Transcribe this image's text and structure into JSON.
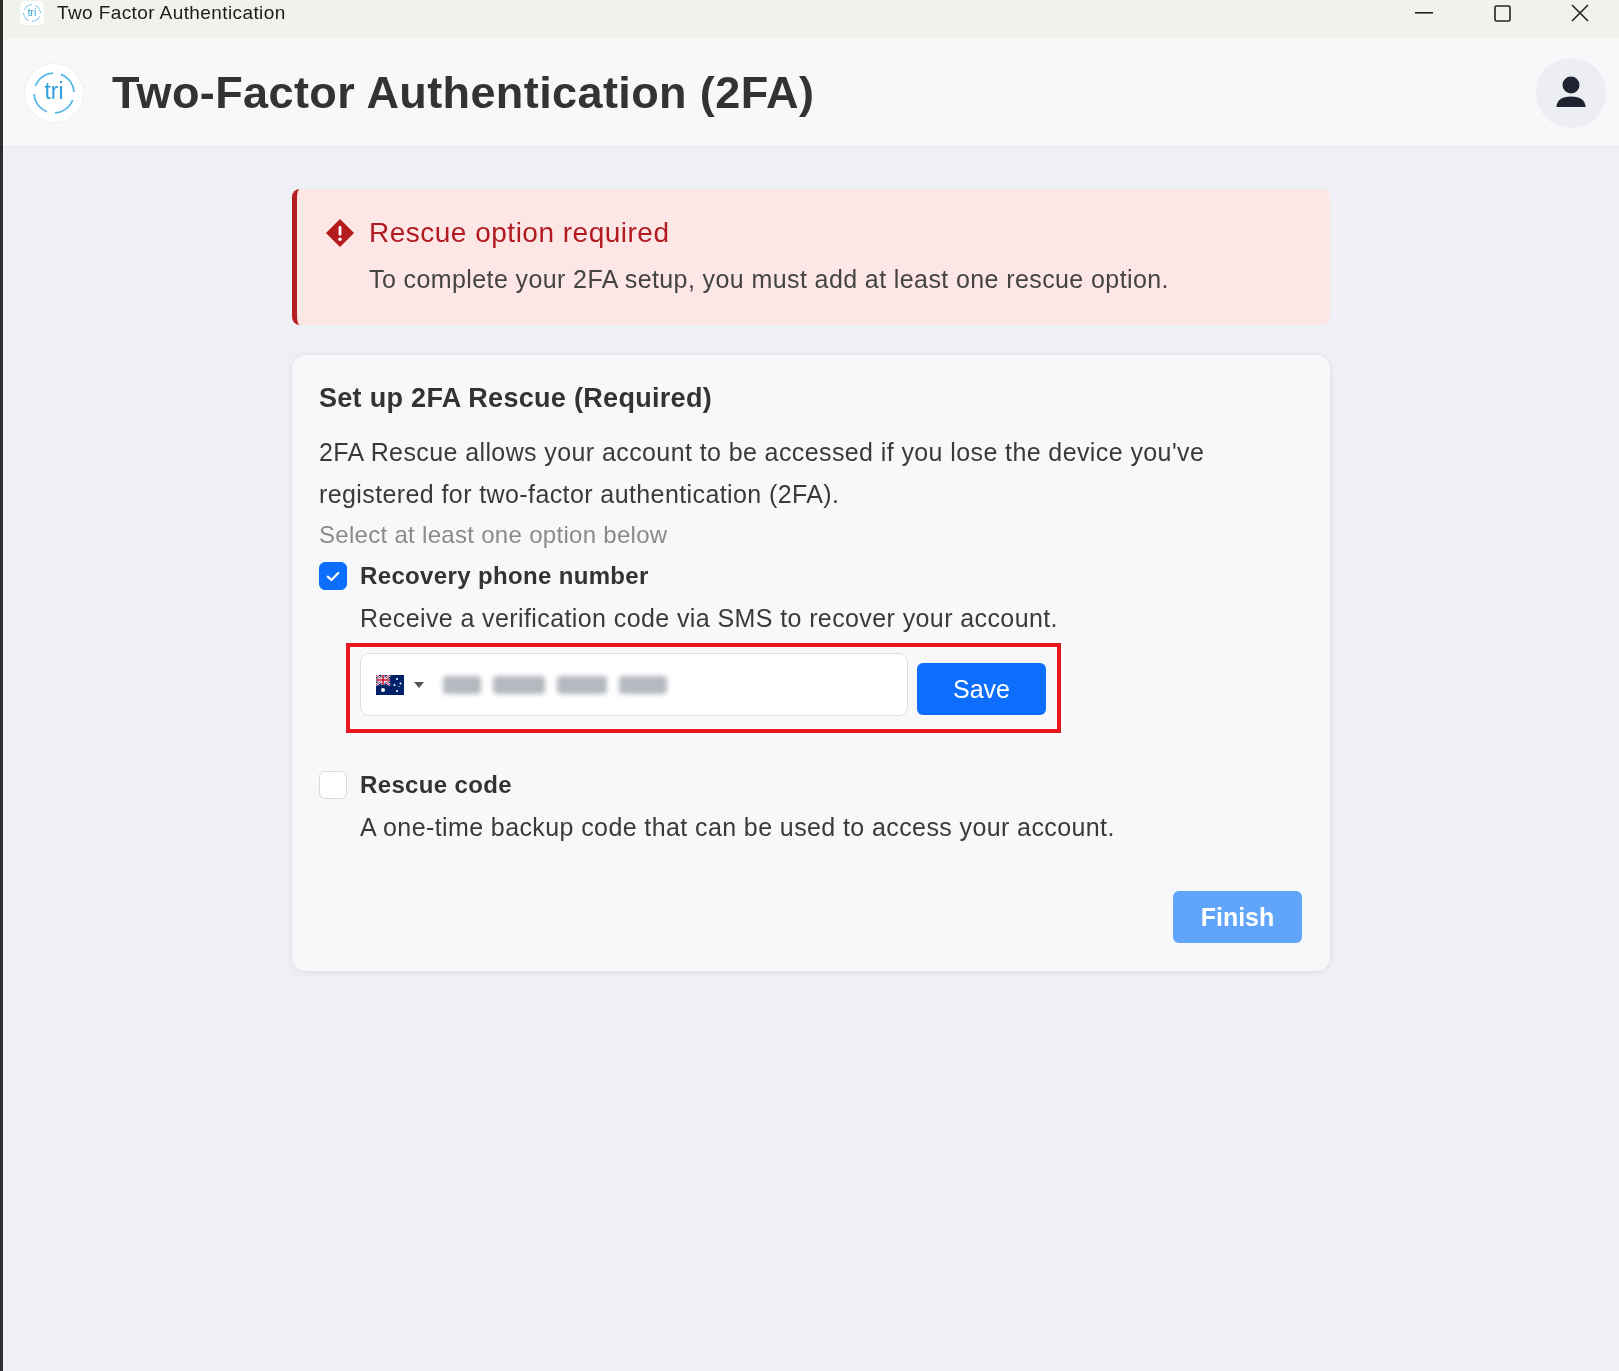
{
  "window": {
    "icon_text": "tri",
    "title": "Two Factor Authentication"
  },
  "header": {
    "logo_text": "tri",
    "title": "Two-Factor Authentication (2FA)"
  },
  "alert": {
    "title": "Rescue option required",
    "message": "To complete your 2FA setup, you must add at least one rescue option."
  },
  "rescue_card": {
    "title": "Set up 2FA Rescue (Required)",
    "description": "2FA Rescue allows your account to be accessed if you lose the device you've registered for two-factor authentication (2FA).",
    "hint": "Select at least one option below",
    "options": [
      {
        "kind": "phone",
        "label": "Recovery phone number",
        "description": "Receive a verification code via SMS to recover your account.",
        "checked": true,
        "highlighted": true,
        "phone_field": {
          "number_blurred": true
        },
        "save_button": {
          "label": "Save",
          "disabled": false
        }
      },
      {
        "kind": "code",
        "label": "Rescue code",
        "description": "A one-time backup code that can be used to access your account.",
        "checked": false
      }
    ],
    "finish_button": {
      "label": "Finish",
      "disabled": true
    }
  }
}
